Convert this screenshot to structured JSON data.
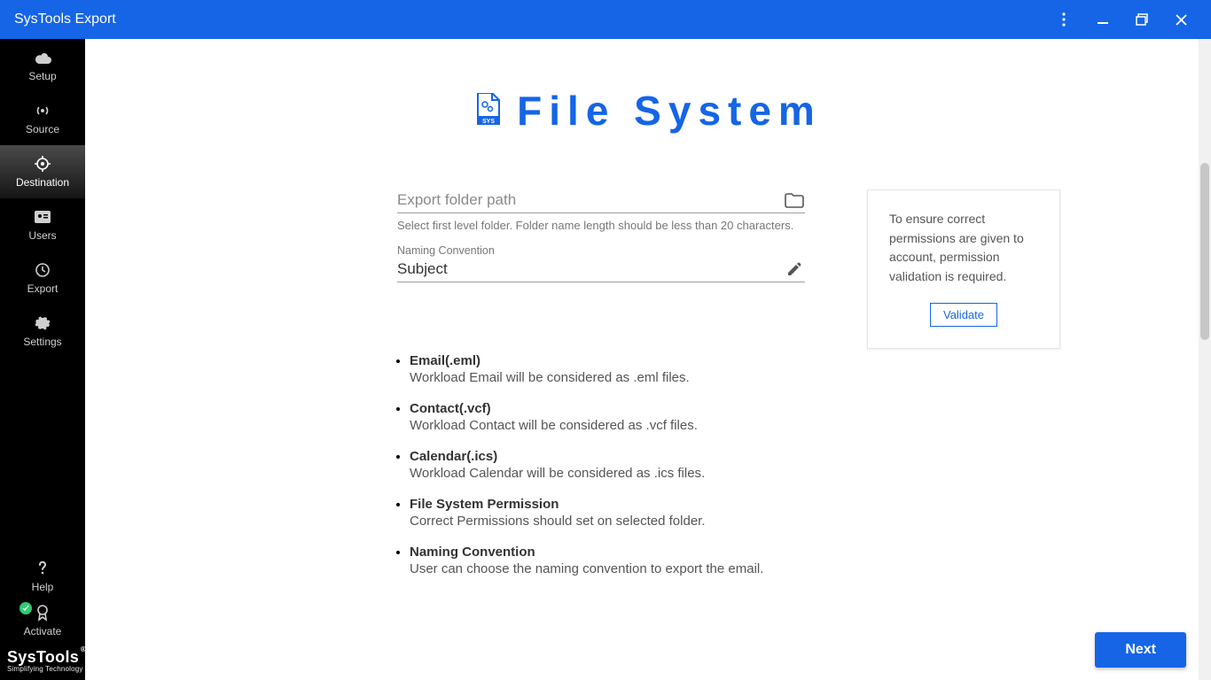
{
  "window": {
    "title": "SysTools Export"
  },
  "sidebar": {
    "items": [
      {
        "label": "Setup"
      },
      {
        "label": "Source"
      },
      {
        "label": "Destination"
      },
      {
        "label": "Users"
      },
      {
        "label": "Export"
      },
      {
        "label": "Settings"
      }
    ],
    "help_label": "Help",
    "activate_label": "Activate",
    "brand": "SysTools",
    "brand_sub": "Simplifying Technology",
    "reg": "®"
  },
  "page": {
    "title": "File System",
    "export_path_placeholder": "Export folder path",
    "export_path_value": "",
    "export_path_helper": "Select first level folder. Folder name length should be less than 20 characters.",
    "naming_label": "Naming Convention",
    "naming_value": "Subject"
  },
  "validate": {
    "text": "To ensure correct permissions are given to account, permission validation is required.",
    "button": "Validate"
  },
  "info": [
    {
      "title": "Email(.eml)",
      "desc": "Workload Email will be considered as .eml files."
    },
    {
      "title": "Contact(.vcf)",
      "desc": "Workload Contact will be considered as .vcf files."
    },
    {
      "title": "Calendar(.ics)",
      "desc": "Workload Calendar will be considered as .ics files."
    },
    {
      "title": "File System Permission",
      "desc": "Correct Permissions should set on selected folder."
    },
    {
      "title": "Naming Convention",
      "desc": "User can choose the naming convention to export the email."
    }
  ],
  "footer": {
    "next": "Next"
  }
}
